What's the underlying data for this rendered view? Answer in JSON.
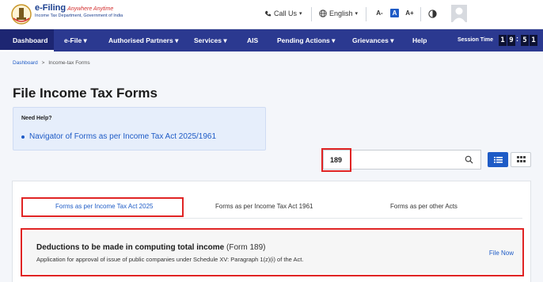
{
  "header": {
    "logo_title": "e-Filing",
    "logo_tagline": "Anywhere Anytime",
    "logo_subtitle": "Income Tax Department, Government of India",
    "call_us": "Call Us",
    "language": "English",
    "font_controls": [
      "A-",
      "A",
      "A+"
    ]
  },
  "nav": {
    "items": [
      {
        "label": "Dashboard"
      },
      {
        "label": "e-File ▾"
      },
      {
        "label": "Authorised Partners ▾"
      },
      {
        "label": "Services ▾"
      },
      {
        "label": "AIS"
      },
      {
        "label": "Pending Actions ▾"
      },
      {
        "label": "Grievances ▾"
      },
      {
        "label": "Help"
      }
    ],
    "session_label": "Session Time",
    "session_digits": [
      "1",
      "9",
      "5",
      "1"
    ]
  },
  "breadcrumb": {
    "home": "Dashboard",
    "separator": ">",
    "current": "Income-tax Forms"
  },
  "page_title": "File Income Tax Forms",
  "help": {
    "title": "Need Help?",
    "link": "Navigator of Forms as per Income Tax Act 2025/1961"
  },
  "search": {
    "value": "189"
  },
  "tabs": [
    {
      "label": "Forms as per Income Tax Act 2025"
    },
    {
      "label": "Forms as per Income Tax Act 1961"
    },
    {
      "label": "Forms as per other Acts"
    }
  ],
  "form_result": {
    "title": "Deductions to be made in computing total income",
    "code": "(Form 189)",
    "description": "Application for approval of issue of public companies under Schedule XV: Paragraph 1(z)(i) of the Act.",
    "action": "File Now"
  },
  "colors": {
    "nav_bg": "#2b3990",
    "accent": "#1e5bc6",
    "highlight": "#e02424"
  }
}
